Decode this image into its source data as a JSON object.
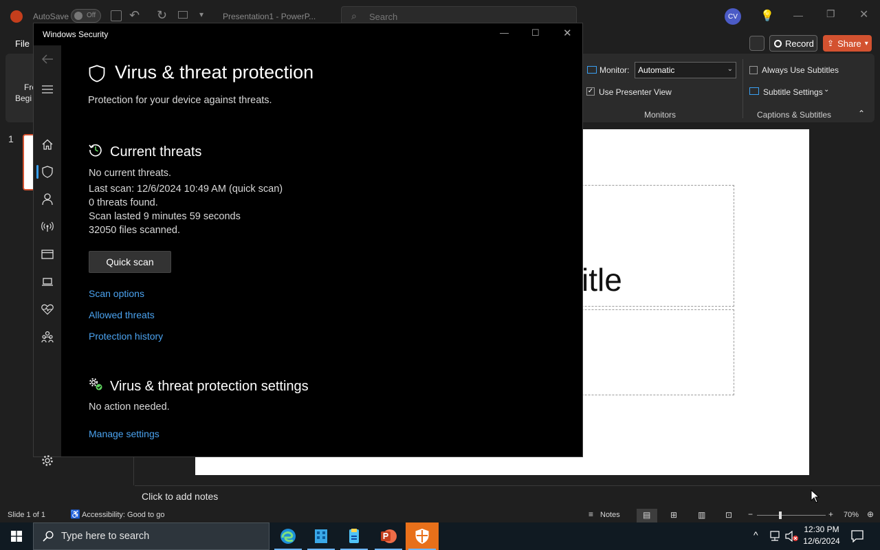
{
  "ppt": {
    "autosave_label": "AutoSave",
    "autosave_state": "Off",
    "doc_title": "Presentation1  -  PowerP...",
    "search_placeholder": "Search",
    "avatar_initials": "CV",
    "file_tab": "File",
    "ribbon_partial_1": "Fro",
    "ribbon_partial_2": "Begi",
    "record_label": "Record",
    "share_label": "Share",
    "monitor_label": "Monitor:",
    "monitor_value": "Automatic",
    "use_presenter_view": "Use Presenter View",
    "monitors_group": "Monitors",
    "always_use_subtitles": "Always Use Subtitles",
    "subtitle_settings": "Subtitle Settings",
    "captions_group": "Captions & Subtitles",
    "slide_number": "1",
    "slide_title_partial": "itle",
    "notes_prompt": "Click to add notes",
    "status_slide": "Slide 1 of 1",
    "status_accessibility": "Accessibility: Good to go",
    "notes_btn": "Notes",
    "zoom_level": "70%"
  },
  "ws": {
    "window_title": "Windows Security",
    "page_title": "Virus & threat protection",
    "page_subtitle": "Protection for your device against threats.",
    "current_threats_heading": "Current threats",
    "threat_lines": [
      "No current threats.",
      "Last scan: 12/6/2024 10:49 AM (quick scan)",
      "0 threats found.",
      "Scan lasted 9 minutes 59 seconds",
      "32050 files scanned."
    ],
    "quick_scan_label": "Quick scan",
    "links": [
      "Scan options",
      "Allowed threats",
      "Protection history"
    ],
    "settings_heading": "Virus & threat protection settings",
    "settings_status": "No action needed.",
    "manage_settings": "Manage settings"
  },
  "taskbar": {
    "search_placeholder": "Type here to search",
    "time": "12:30 PM",
    "date": "12/6/2024"
  },
  "colors": {
    "link": "#4ba3f0",
    "share_accent": "#d35230",
    "nav_selected": "#3aa0f3"
  }
}
